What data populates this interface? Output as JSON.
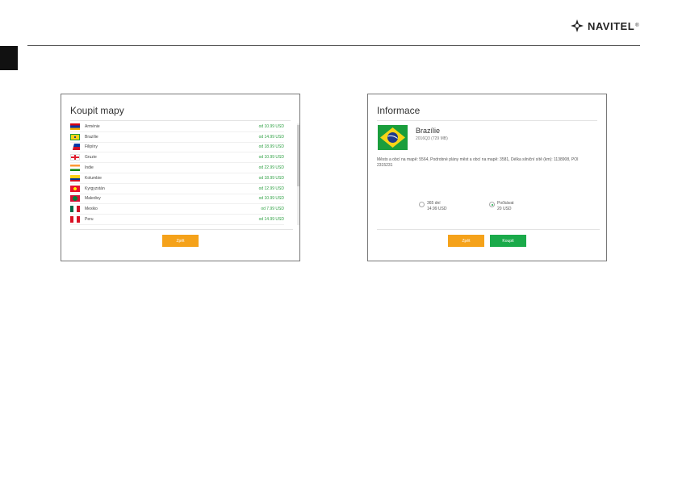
{
  "brand": {
    "name": "NAVITEL",
    "reg": "®"
  },
  "left_panel": {
    "title": "Koupit mapy",
    "rows": [
      {
        "country": "Arménie",
        "price": "od 10.99 USD"
      },
      {
        "country": "Brazílie",
        "price": "od 14.99 USD"
      },
      {
        "country": "Filipíny",
        "price": "od 18.99 USD"
      },
      {
        "country": "Gruzie",
        "price": "od 10.99 USD"
      },
      {
        "country": "Indie",
        "price": "od 22.99 USD"
      },
      {
        "country": "Kolumbie",
        "price": "od 18.99 USD"
      },
      {
        "country": "Kyrgyzstán",
        "price": "od 12.99 USD"
      },
      {
        "country": "Maledivy",
        "price": "od 10.99 USD"
      },
      {
        "country": "Mexiko",
        "price": "od 7.99 USD"
      },
      {
        "country": "Peru",
        "price": "od 14.99 USD"
      }
    ],
    "back_label": "Zpět"
  },
  "right_panel": {
    "title": "Informace",
    "country_name": "Brazílie",
    "version": "2016Q3 (729 MB)",
    "description": "Město a obcí na mapě: 5564, Podrobné plány měst a obcí na mapě: 3581, Délka silniční sítě (km): 1138908, POI 2315231",
    "option_365_line1": "365 dní",
    "option_365_line2": "14.99 USD",
    "option_forever_line1": "Počkávat",
    "option_forever_line2": "20 USD",
    "back_label": "Zpět",
    "buy_label": "Koupit"
  },
  "colors": {
    "price_green": "#2ea043",
    "orange": "#f5a21a",
    "green": "#1aaa4a"
  }
}
